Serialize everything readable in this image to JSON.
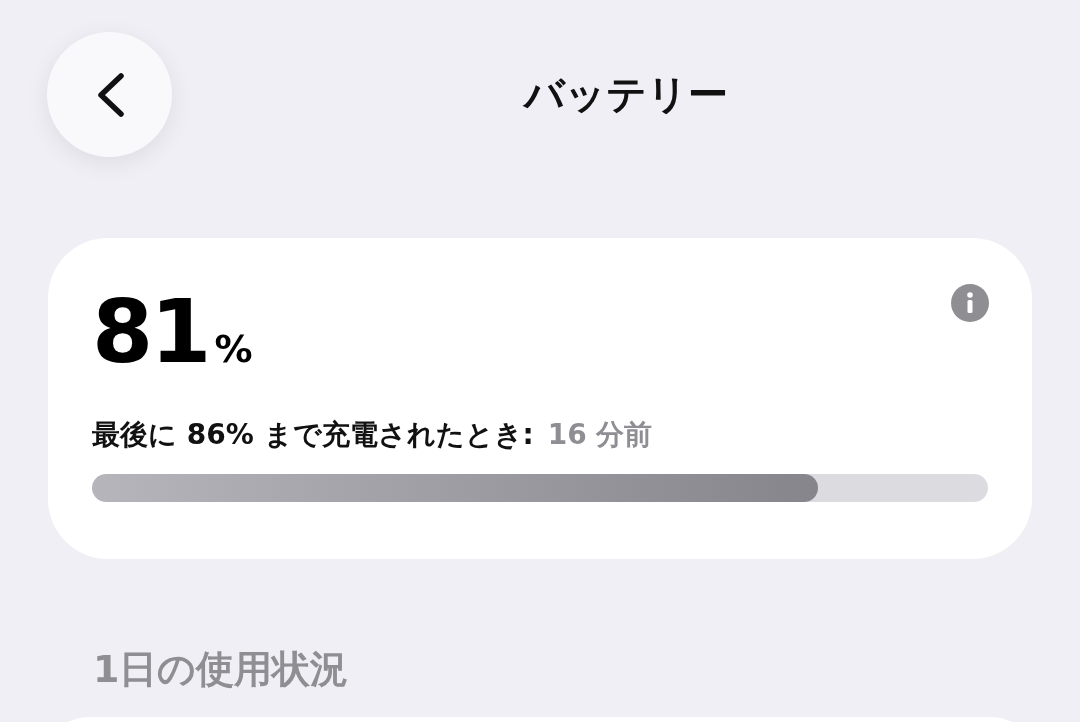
{
  "header": {
    "title": "バッテリー"
  },
  "battery": {
    "percent": "81",
    "unit": "%",
    "last_charge_label": "最後に 86% まで充電されたとき:",
    "last_charge_time": "16 分前",
    "level": 0.81
  },
  "usage": {
    "heading": "1日の使用状況"
  }
}
